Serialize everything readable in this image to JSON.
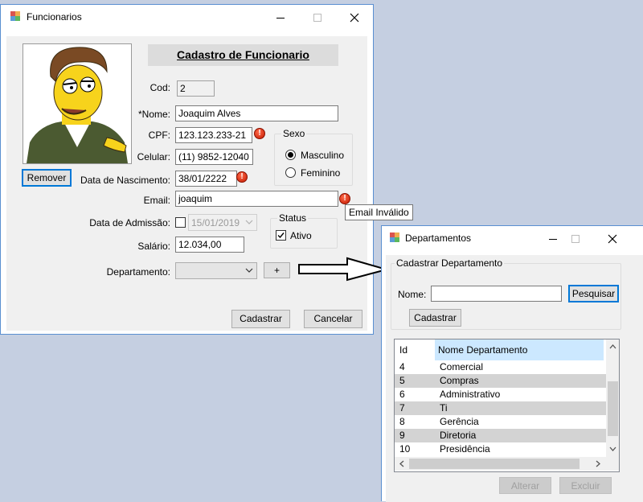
{
  "funcionarios": {
    "window_title": "Funcionarios",
    "header": "Cadastro de Funcionario",
    "remover_label": "Remover",
    "cod": {
      "label": "Cod:",
      "value": "2"
    },
    "nome": {
      "label": "*Nome:",
      "value": "Joaquim Alves"
    },
    "cpf": {
      "label": "CPF:",
      "value": "123.123.233-21"
    },
    "celular": {
      "label": "Celular:",
      "value": "(11) 9852-12040"
    },
    "nascimento": {
      "label": "Data de Nascimento:",
      "value": "38/01/2222"
    },
    "email": {
      "label": "Email:",
      "value": "joaquim"
    },
    "admissao": {
      "label": "Data de Admissão:",
      "value": "15/01/2019",
      "checked": false
    },
    "salario": {
      "label": "Salário:",
      "value": "12.034,00"
    },
    "departamento": {
      "label": "Departamento:",
      "value": "",
      "add_label": "+"
    },
    "sexo": {
      "title": "Sexo",
      "options": [
        "Masculino",
        "Feminino"
      ],
      "selected": "Masculino"
    },
    "status": {
      "title": "Status",
      "ativo_label": "Ativo",
      "ativo_checked": true
    },
    "tooltip": "Email Inválido",
    "cadastrar_label": "Cadastrar",
    "cancelar_label": "Cancelar"
  },
  "departamentos": {
    "window_title": "Departamentos",
    "group_title": "Cadastrar Departamento",
    "nome_label": "Nome:",
    "nome_value": "",
    "pesquisar_label": "Pesquisar",
    "cadastrar_label": "Cadastrar",
    "columns": [
      "Id",
      "Nome Departamento"
    ],
    "rows": [
      {
        "id": "4",
        "nome": "Comercial"
      },
      {
        "id": "5",
        "nome": "Compras"
      },
      {
        "id": "6",
        "nome": "Administrativo"
      },
      {
        "id": "7",
        "nome": "Ti"
      },
      {
        "id": "8",
        "nome": "Gerência"
      },
      {
        "id": "9",
        "nome": "Diretoria"
      },
      {
        "id": "10",
        "nome": "Presidência"
      }
    ],
    "alterar_label": "Alterar",
    "excluir_label": "Excluir"
  },
  "colors": {
    "desktop": "#c5cfe1",
    "window_border": "#5a8fd1",
    "error_icon": "#c41a00",
    "grid_header_highlight": "#cce8ff",
    "focus_border": "#0078d7"
  }
}
